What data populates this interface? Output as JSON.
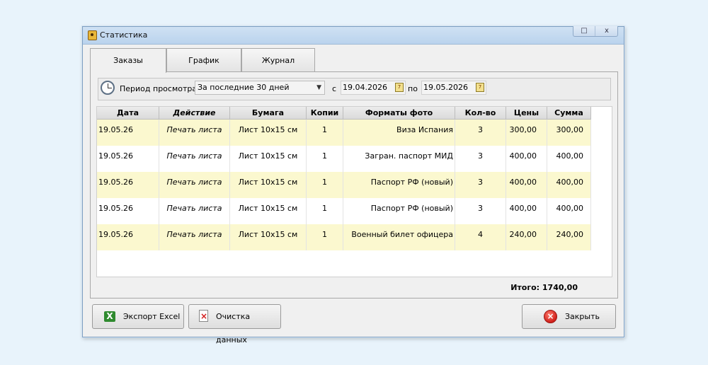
{
  "window": {
    "title": "Статистика",
    "maximize": "□",
    "close": "x"
  },
  "tabs": [
    {
      "label": "Заказы",
      "active": true
    },
    {
      "label": "График",
      "active": false
    },
    {
      "label": "Журнал",
      "active": false
    }
  ],
  "filter": {
    "period_label": "Период просмотра:",
    "period_value": "За последние 30 дней",
    "from_label": "с",
    "from_date": "19.04.2026",
    "to_label": "по",
    "to_date": "19.05.2026",
    "calendar_glyph": "7"
  },
  "table": {
    "columns": [
      "Дата",
      "Действие",
      "Бумага",
      "Копии",
      "Форматы фото",
      "Кол-во",
      "Цены",
      "Сумма"
    ],
    "rows": [
      [
        "19.05.26",
        "Печать листа",
        "Лист 10x15 см",
        "1",
        "Виза Испания",
        "3",
        "300,00",
        "300,00"
      ],
      [
        "19.05.26",
        "Печать листа",
        "Лист 10x15 см",
        "1",
        "Загран. паспорт МИД",
        "3",
        "400,00",
        "400,00"
      ],
      [
        "19.05.26",
        "Печать листа",
        "Лист 10x15 см",
        "1",
        "Паспорт РФ (новый)",
        "3",
        "400,00",
        "400,00"
      ],
      [
        "19.05.26",
        "Печать листа",
        "Лист 10x15 см",
        "1",
        "Паспорт РФ (новый)",
        "3",
        "400,00",
        "400,00"
      ],
      [
        "19.05.26",
        "Печать листа",
        "Лист 10x15 см",
        "1",
        "Военный билет офицера",
        "4",
        "240,00",
        "240,00"
      ]
    ]
  },
  "total": "Итого: 1740,00",
  "buttons": {
    "export_excel": "Экспорт Excel",
    "clear_data": "Очистка данных",
    "close": "Закрыть"
  },
  "icons": {
    "app": "app-icon",
    "clock": "clock-icon",
    "calendar": "calendar-icon",
    "excel": "excel-icon",
    "clear": "clear-data-icon",
    "close": "close-circle-icon"
  }
}
